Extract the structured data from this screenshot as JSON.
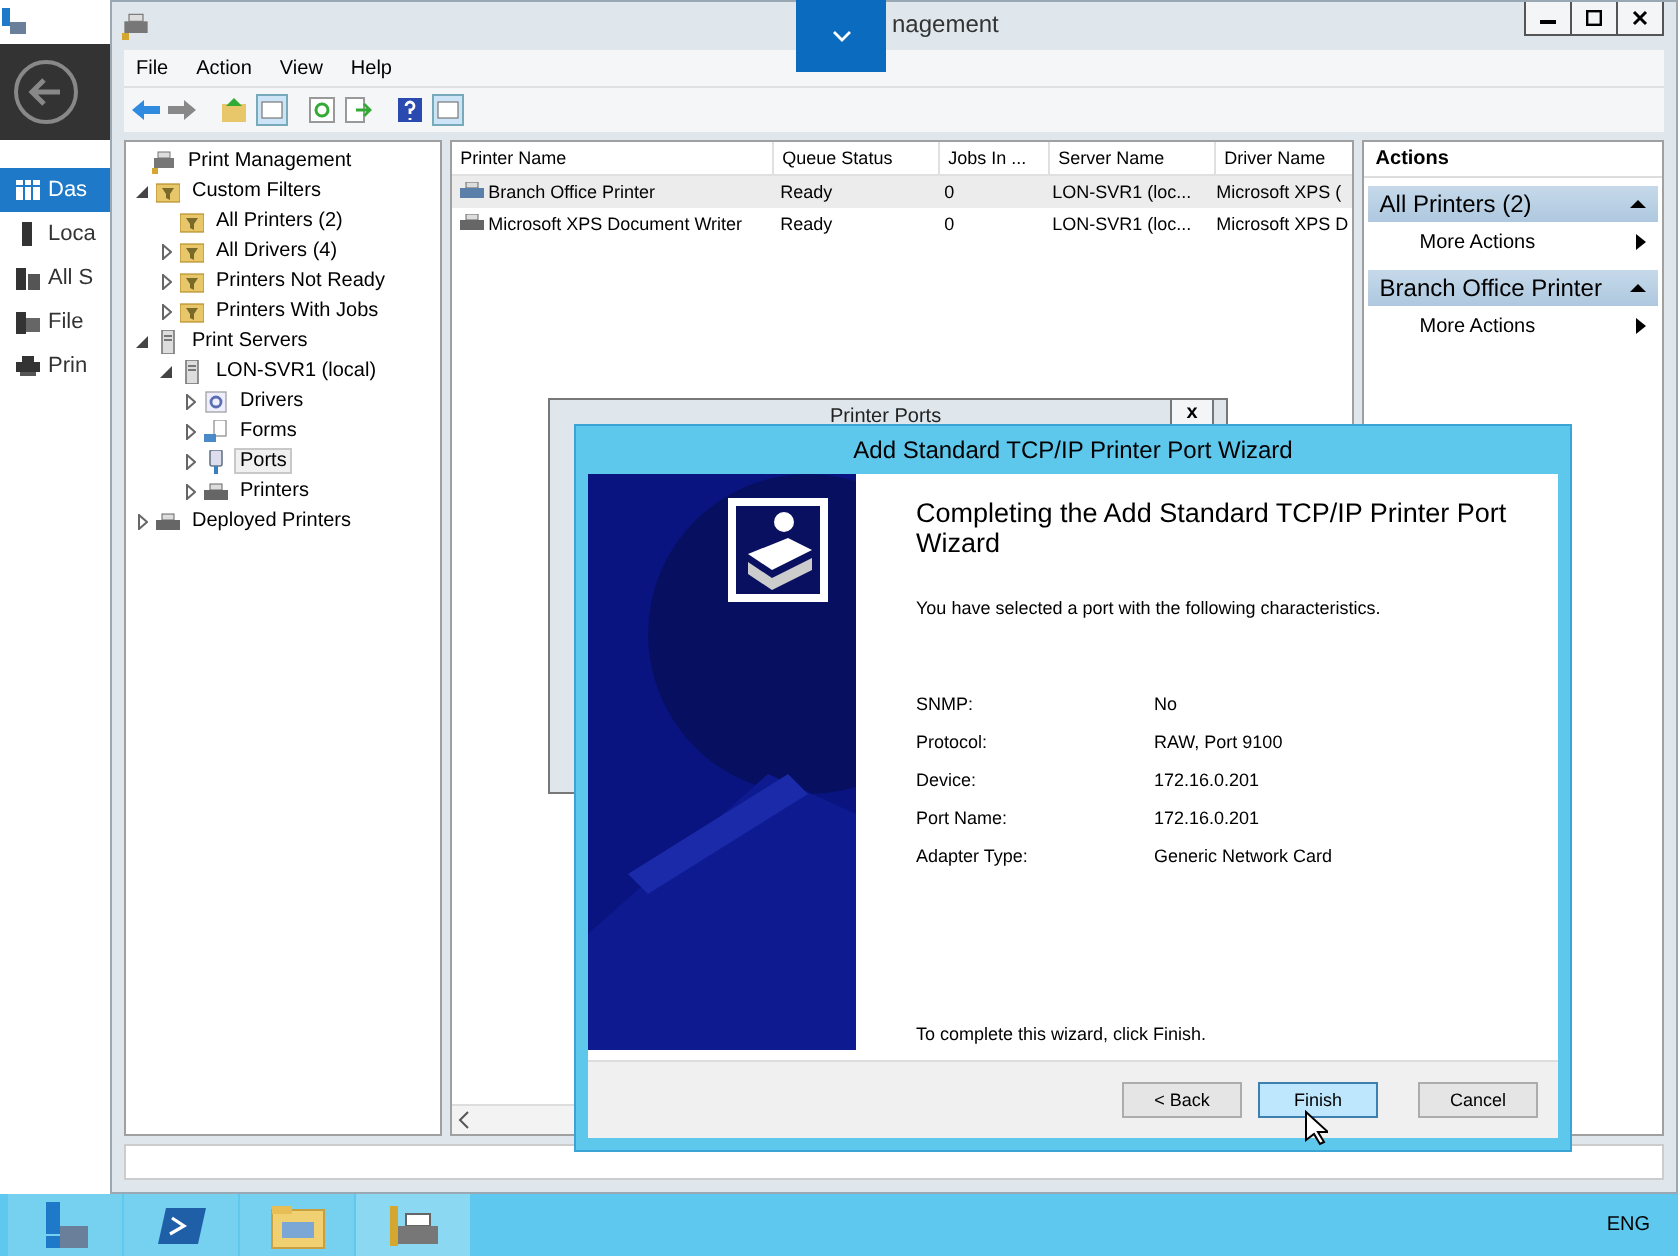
{
  "background_window": {
    "nav_items": [
      {
        "label": "Das",
        "selected": true
      },
      {
        "label": "Loca",
        "selected": false
      },
      {
        "label": "All S",
        "selected": false
      },
      {
        "label": "File",
        "selected": false
      },
      {
        "label": "Prin",
        "selected": false
      }
    ]
  },
  "window": {
    "title": "nagement",
    "menu": [
      "File",
      "Action",
      "View",
      "Help"
    ],
    "tree": [
      {
        "label": "Print Management",
        "kind": "root",
        "children": [
          {
            "label": "Custom Filters",
            "kind": "filter",
            "expanded": true,
            "children": [
              {
                "label": "All Printers (2)",
                "kind": "filter"
              },
              {
                "label": "All Drivers (4)",
                "kind": "filter",
                "expanded": false
              },
              {
                "label": "Printers Not Ready",
                "kind": "filter",
                "expanded": false
              },
              {
                "label": "Printers With Jobs",
                "kind": "filter",
                "expanded": false
              }
            ]
          },
          {
            "label": "Print Servers",
            "kind": "server",
            "expanded": true,
            "children": [
              {
                "label": "LON-SVR1 (local)",
                "kind": "server",
                "expanded": true,
                "children": [
                  {
                    "label": "Drivers",
                    "kind": "drivers",
                    "expanded": false,
                    "selected": false
                  },
                  {
                    "label": "Forms",
                    "kind": "forms",
                    "expanded": false,
                    "selected": false
                  },
                  {
                    "label": "Ports",
                    "kind": "ports",
                    "expanded": false,
                    "selected": true
                  },
                  {
                    "label": "Printers",
                    "kind": "printers",
                    "expanded": false,
                    "selected": false
                  }
                ]
              }
            ]
          },
          {
            "label": "Deployed Printers",
            "kind": "printers",
            "expanded": false
          }
        ]
      }
    ],
    "table": {
      "columns": [
        "Printer Name",
        "Queue Status",
        "Jobs In ...",
        "Server Name",
        "Driver Name"
      ],
      "rows": [
        {
          "selected": true,
          "cells": [
            "Branch Office Printer",
            "Ready",
            "0",
            "LON-SVR1 (loc...",
            "Microsoft XPS ("
          ]
        },
        {
          "selected": false,
          "cells": [
            "Microsoft XPS Document Writer",
            "Ready",
            "0",
            "LON-SVR1 (loc...",
            "Microsoft XPS D"
          ]
        }
      ]
    },
    "actions": {
      "title": "Actions",
      "groups": [
        {
          "header": "All Printers (2)",
          "items": [
            "More Actions"
          ]
        },
        {
          "header": "Branch Office Printer",
          "items": [
            "More Actions"
          ]
        }
      ]
    }
  },
  "printer_ports_dialog": {
    "title": "Printer Ports",
    "close": "x"
  },
  "wizard": {
    "title": "Add Standard TCP/IP Printer Port Wizard",
    "heading": "Completing the Add Standard TCP/IP Printer Port Wizard",
    "intro": "You have selected a port with the following characteristics.",
    "fields": [
      {
        "label": "SNMP:",
        "value": "No"
      },
      {
        "label": "Protocol:",
        "value": "RAW, Port 9100"
      },
      {
        "label": "Device:",
        "value": "172.16.0.201"
      },
      {
        "label": "Port Name:",
        "value": "172.16.0.201"
      },
      {
        "label": "Adapter Type:",
        "value": "Generic Network Card"
      }
    ],
    "footer": "To complete this wizard, click Finish.",
    "buttons": [
      {
        "label": "< Back",
        "selected": false
      },
      {
        "label": "Finish",
        "selected": true
      },
      {
        "label": "Cancel",
        "selected": false
      }
    ]
  },
  "taskbar": {
    "apps": [
      {
        "selected": false
      },
      {
        "selected": false
      },
      {
        "selected": false
      },
      {
        "selected": true
      }
    ],
    "language": "ENG"
  }
}
